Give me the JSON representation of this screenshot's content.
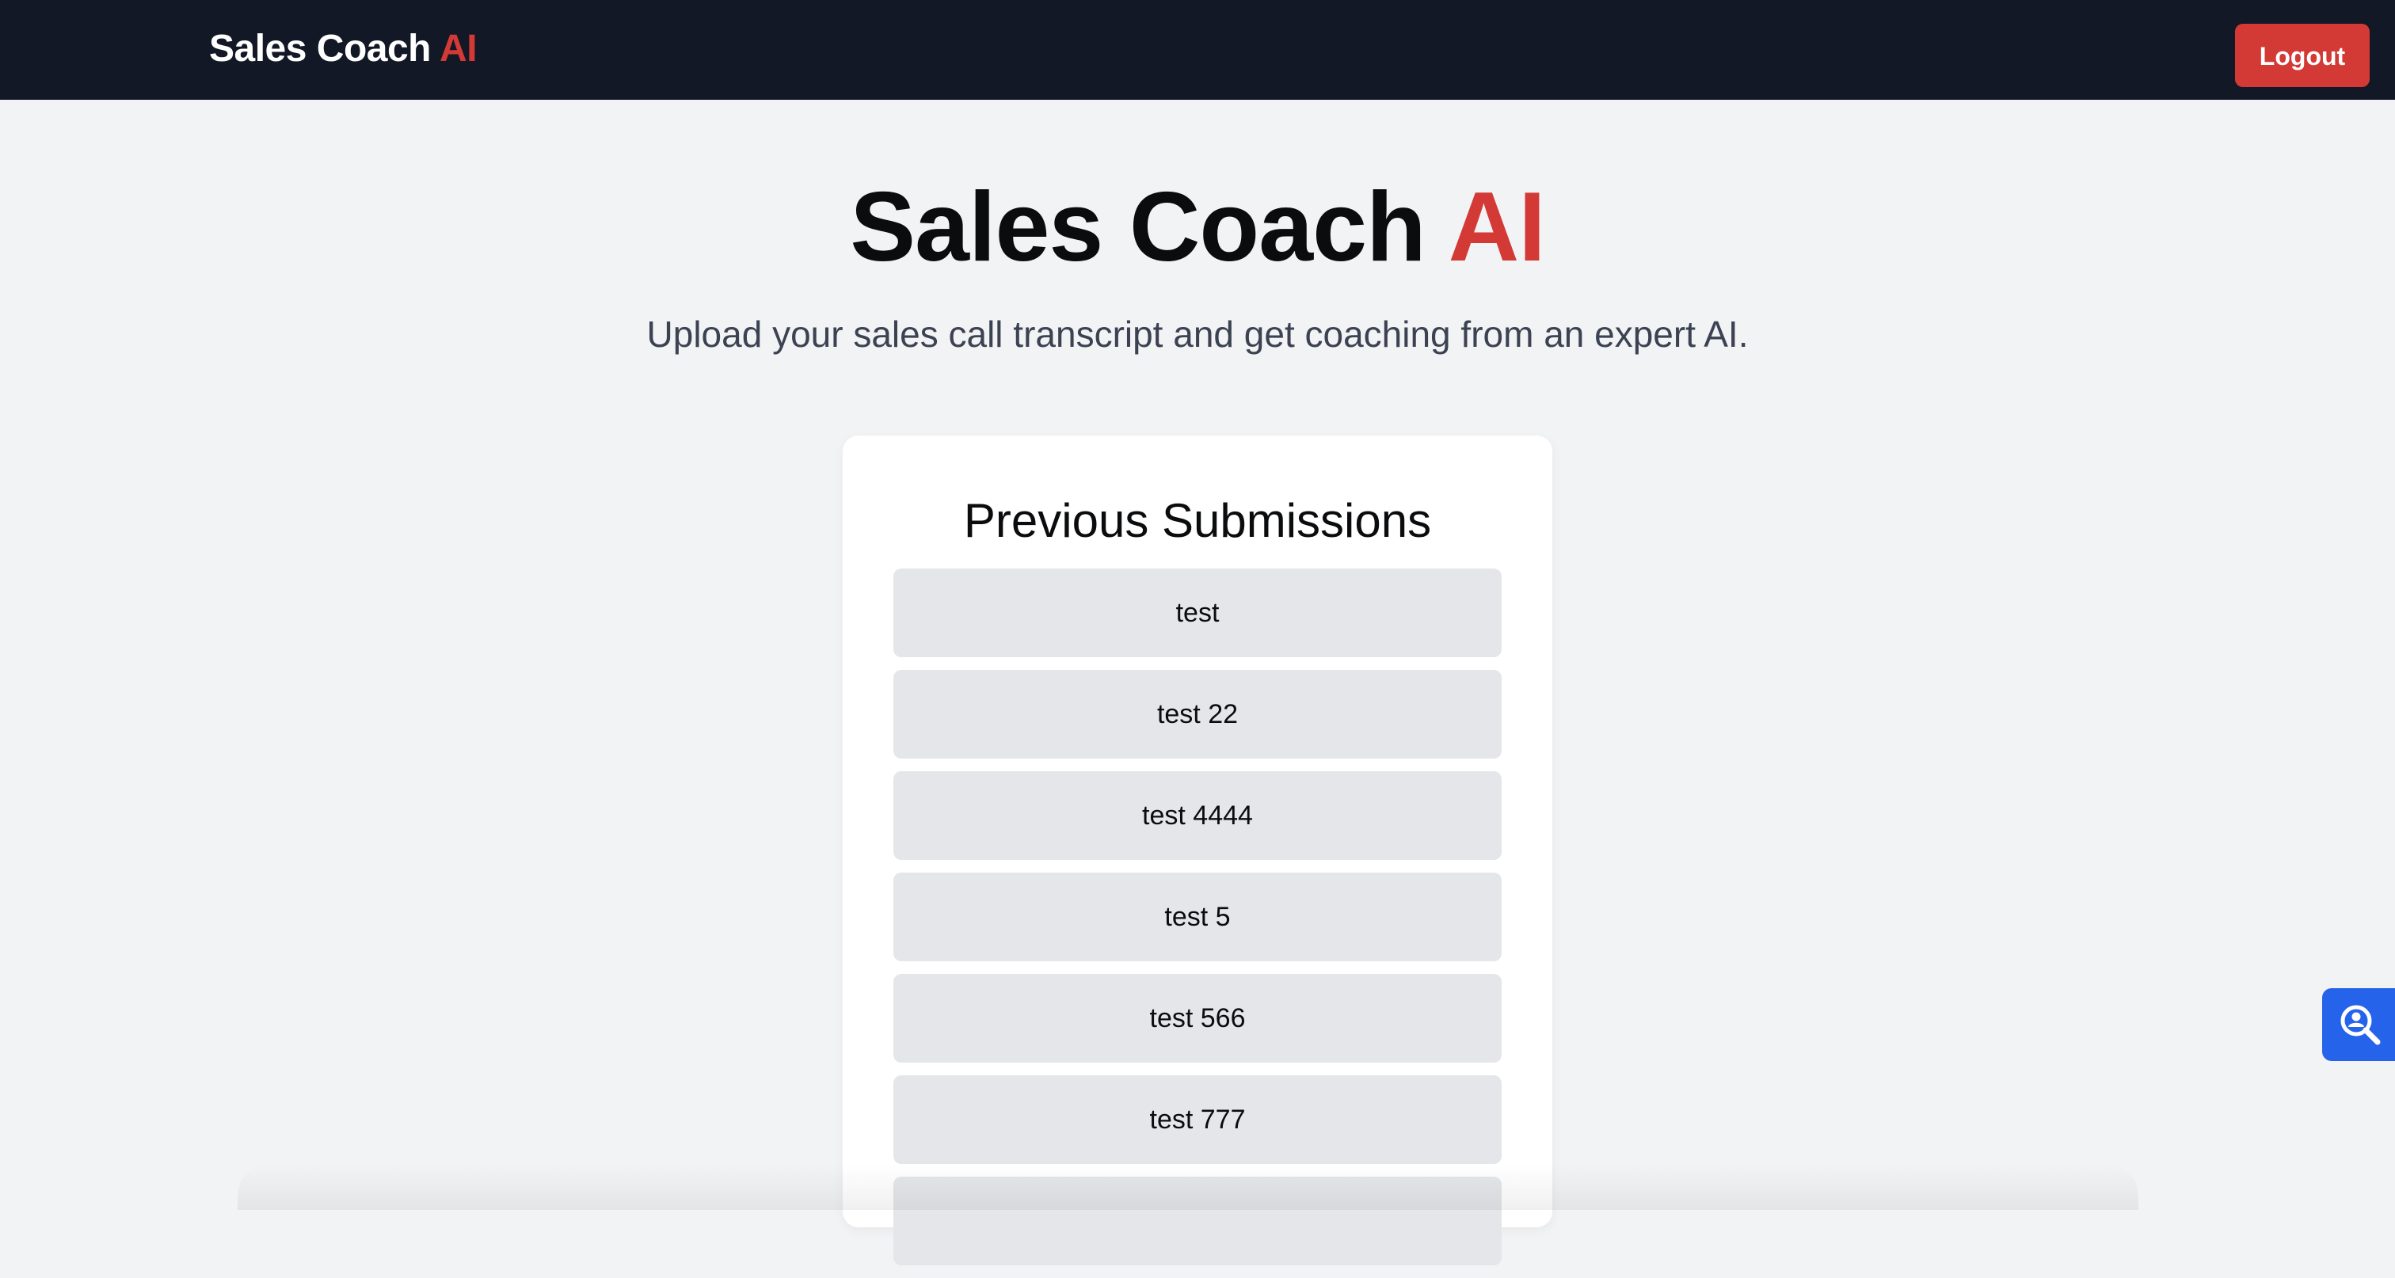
{
  "navbar": {
    "brand_main": "Sales Coach",
    "brand_accent": "AI",
    "logout_label": "Logout"
  },
  "hero": {
    "title_main": "Sales Coach",
    "title_accent": "AI",
    "subtitle": "Upload your sales call transcript and get coaching from an expert AI."
  },
  "submissions": {
    "title": "Previous Submissions",
    "items": [
      {
        "label": "test"
      },
      {
        "label": "test 22"
      },
      {
        "label": "test 4444"
      },
      {
        "label": "test 5"
      },
      {
        "label": "test 566"
      },
      {
        "label": "test 777"
      },
      {
        "label": ""
      }
    ]
  },
  "floating_button": {
    "icon": "search-user-icon",
    "color": "#2563eb"
  },
  "colors": {
    "navbar_bg": "#121826",
    "accent": "#d33a35",
    "page_bg": "#f2f3f5",
    "item_bg": "#e5e6e9"
  }
}
